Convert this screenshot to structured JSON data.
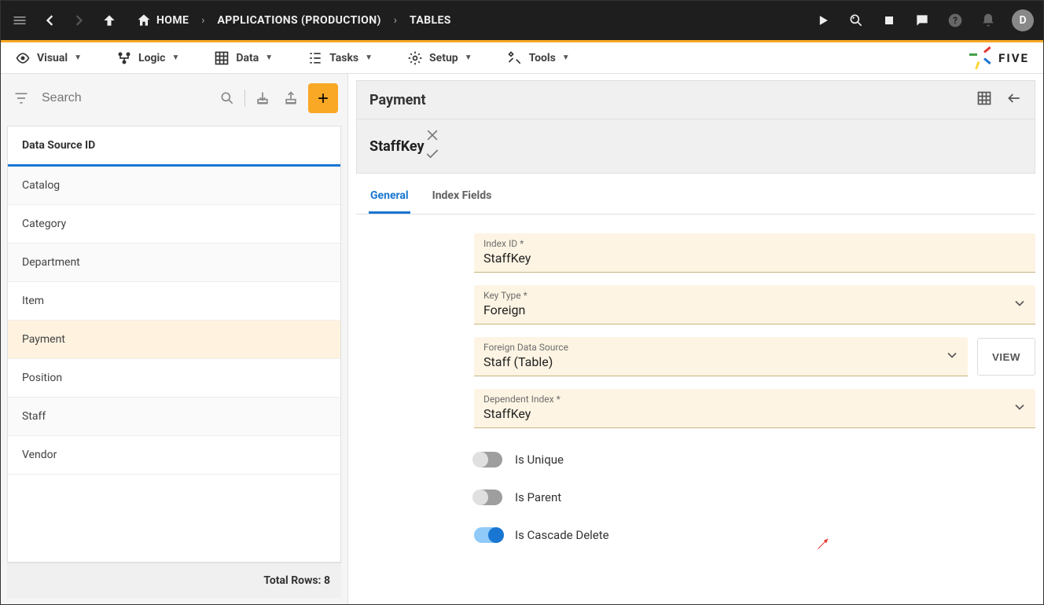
{
  "topbar": {
    "home": "HOME",
    "crumb1": "APPLICATIONS (PRODUCTION)",
    "crumb2": "TABLES",
    "avatar": "D"
  },
  "menu": {
    "visual": "Visual",
    "logic": "Logic",
    "data": "Data",
    "tasks": "Tasks",
    "setup": "Setup",
    "tools": "Tools",
    "brand": "FIVE"
  },
  "sidebar": {
    "search_placeholder": "Search",
    "header": "Data Source ID",
    "items": [
      "Catalog",
      "Category",
      "Department",
      "Item",
      "Payment",
      "Position",
      "Staff",
      "Vendor"
    ],
    "selected": "Payment",
    "footer": "Total Rows: 8"
  },
  "main": {
    "title": "Payment",
    "subtitle": "StaffKey",
    "tabs": {
      "general": "General",
      "index_fields": "Index Fields"
    },
    "fields": {
      "index_id": {
        "label": "Index ID *",
        "value": "StaffKey"
      },
      "key_type": {
        "label": "Key Type *",
        "value": "Foreign"
      },
      "foreign_ds": {
        "label": "Foreign Data Source",
        "value": "Staff (Table)"
      },
      "dep_index": {
        "label": "Dependent Index *",
        "value": "StaffKey"
      },
      "view_btn": "VIEW"
    },
    "toggles": {
      "unique": "Is Unique",
      "parent": "Is Parent",
      "cascade": "Is Cascade Delete"
    }
  }
}
